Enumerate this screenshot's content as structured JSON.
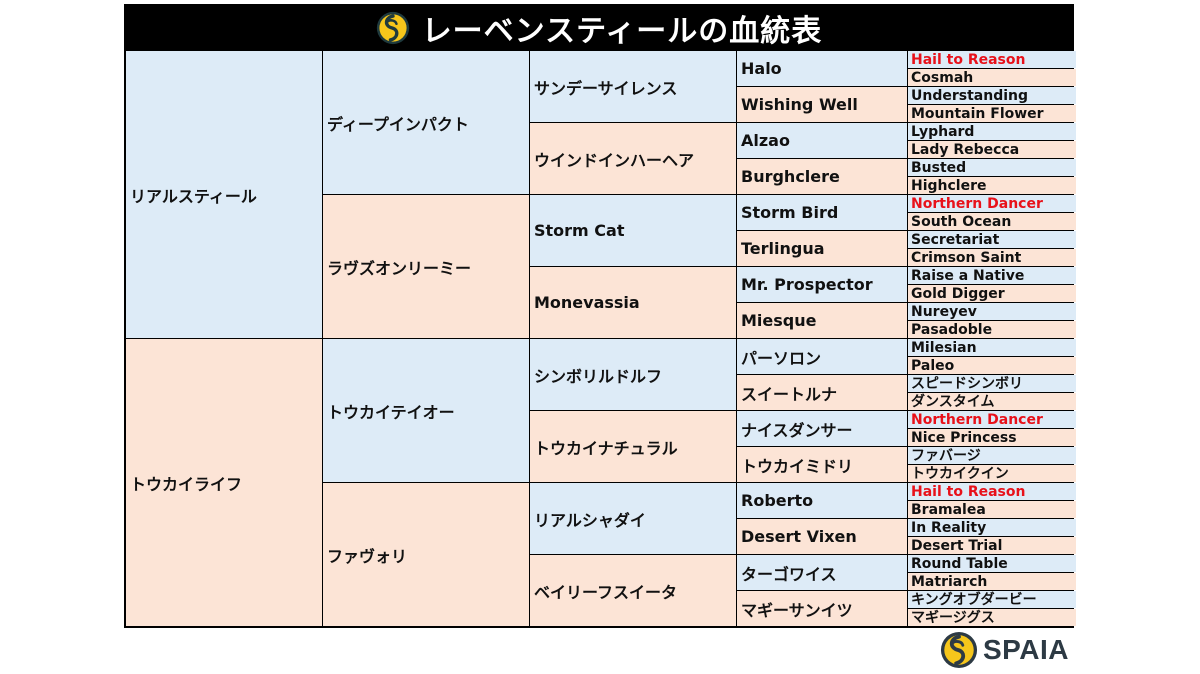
{
  "header": {
    "title": "レーベンスティールの血統表",
    "logo_icon": "spaia-swirl-icon"
  },
  "colors": {
    "male_bg": "#ddebf7",
    "female_bg": "#fce4d6",
    "highlight_text": "#e8111a",
    "header_bg": "#000000"
  },
  "pedigree": {
    "gen1": [
      "リアルスティール",
      "トウカイライフ"
    ],
    "gen2": [
      "ディープインパクト",
      "ラヴズオンリーミー",
      "トウカイテイオー",
      "ファヴォリ"
    ],
    "gen3": [
      "サンデーサイレンス",
      "ウインドインハーヘア",
      "Storm Cat",
      "Monevassia",
      "シンボリルドルフ",
      "トウカイナチュラル",
      "リアルシャダイ",
      "ベイリーフスイータ"
    ],
    "gen4": [
      "Halo",
      "Wishing Well",
      "Alzao",
      "Burghclere",
      "Storm Bird",
      "Terlingua",
      "Mr. Prospector",
      "Miesque",
      "パーソロン",
      "スイートルナ",
      "ナイスダンサー",
      "トウカイミドリ",
      "Roberto",
      "Desert Vixen",
      "ターゴワイス",
      "マギーサンイツ"
    ],
    "gen5": [
      {
        "name": "Hail to Reason",
        "highlight": true
      },
      {
        "name": "Cosmah",
        "highlight": false
      },
      {
        "name": "Understanding",
        "highlight": false
      },
      {
        "name": "Mountain Flower",
        "highlight": false
      },
      {
        "name": "Lyphard",
        "highlight": false
      },
      {
        "name": "Lady Rebecca",
        "highlight": false
      },
      {
        "name": "Busted",
        "highlight": false
      },
      {
        "name": "Highclere",
        "highlight": false
      },
      {
        "name": "Northern Dancer",
        "highlight": true
      },
      {
        "name": "South Ocean",
        "highlight": false
      },
      {
        "name": "Secretariat",
        "highlight": false
      },
      {
        "name": "Crimson Saint",
        "highlight": false
      },
      {
        "name": "Raise a Native",
        "highlight": false
      },
      {
        "name": "Gold Digger",
        "highlight": false
      },
      {
        "name": "Nureyev",
        "highlight": false
      },
      {
        "name": "Pasadoble",
        "highlight": false
      },
      {
        "name": "Milesian",
        "highlight": false
      },
      {
        "name": "Paleo",
        "highlight": false
      },
      {
        "name": "スピードシンボリ",
        "highlight": false
      },
      {
        "name": "ダンスタイム",
        "highlight": false
      },
      {
        "name": "Northern Dancer",
        "highlight": true
      },
      {
        "name": "Nice Princess",
        "highlight": false
      },
      {
        "name": "ファバージ",
        "highlight": false
      },
      {
        "name": "トウカイクイン",
        "highlight": false
      },
      {
        "name": "Hail to Reason",
        "highlight": true
      },
      {
        "name": "Bramalea",
        "highlight": false
      },
      {
        "name": "In Reality",
        "highlight": false
      },
      {
        "name": "Desert Trial",
        "highlight": false
      },
      {
        "name": "Round Table",
        "highlight": false
      },
      {
        "name": "Matriarch",
        "highlight": false
      },
      {
        "name": "キングオブダービー",
        "highlight": false
      },
      {
        "name": "マギージグス",
        "highlight": false
      }
    ]
  },
  "footer": {
    "brand": "SPAIA",
    "logo_icon": "spaia-swirl-icon"
  }
}
